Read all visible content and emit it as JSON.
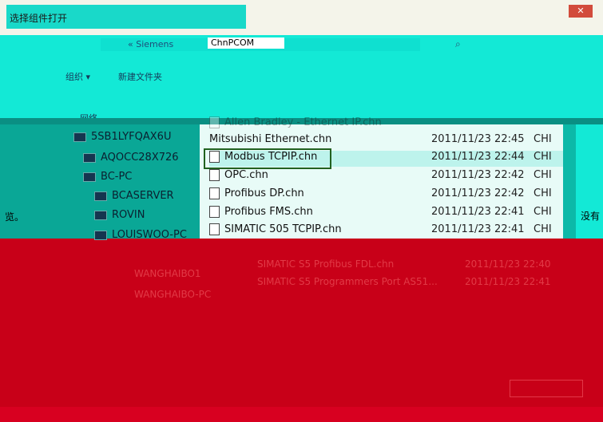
{
  "window": {
    "title": "选择组件打开",
    "close_label": "✕"
  },
  "address": {
    "segments": [
      "«  Siemens",
      "ChnPCOM"
    ],
    "search_icon": "search-icon"
  },
  "toolbar": {
    "organize": "组织 ▾",
    "new_folder": "新建文件夹"
  },
  "tree": {
    "network_label": "网络",
    "items": [
      "5SB1LYFQAX6U",
      "AQOCC28X726",
      "BC-PC",
      "BCASERVER",
      "ROVIN",
      "LOUISWOO-PC",
      "WANGHAIBO1",
      "WANGHAIBO-PC"
    ],
    "left_edge_text": "览。"
  },
  "files": [
    {
      "name": "Allen Bradley - Ethernet IP.chn",
      "date": "",
      "type": ""
    },
    {
      "name": "Mitsubishi Ethernet.chn",
      "date": "2011/11/23 22:45",
      "type": "CHI"
    },
    {
      "name": "Modbus TCPIP.chn",
      "date": "2011/11/23 22:44",
      "type": "CHI"
    },
    {
      "name": "OPC.chn",
      "date": "2011/11/23 22:42",
      "type": "CHI"
    },
    {
      "name": "Profibus DP.chn",
      "date": "2011/11/23 22:42",
      "type": "CHI"
    },
    {
      "name": "Profibus FMS.chn",
      "date": "2011/11/23 22:41",
      "type": "CHI"
    },
    {
      "name": "SIMATIC 505 TCPIP.chn",
      "date": "2011/11/23 22:41",
      "type": "CHI"
    },
    {
      "name": "SIMATIC S5 Profibus FDL.chn",
      "date": "2011/11/23 22:40",
      "type": "CHI"
    },
    {
      "name": "SIMATIC S5 Programmers Port AS51...",
      "date": "2011/11/23 22:41",
      "type": "CHI"
    }
  ],
  "right_edge_text": "没有",
  "colors": {
    "accent": "#13e9d6",
    "background": "#c80018",
    "selection_border": "#21611f"
  }
}
